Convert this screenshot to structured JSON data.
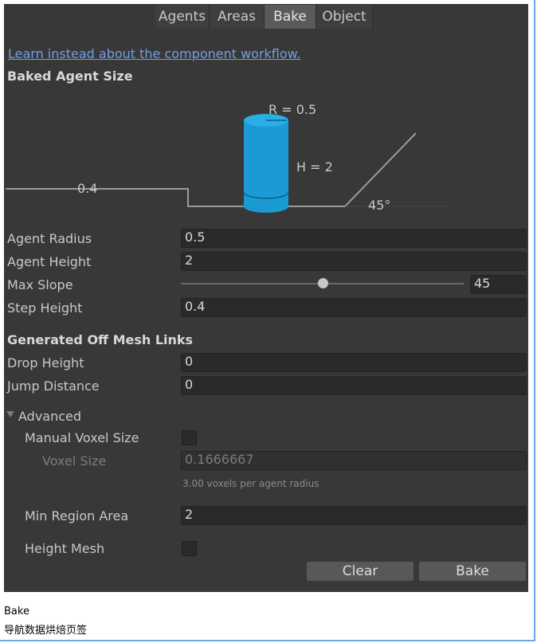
{
  "tabs": [
    "Agents",
    "Areas",
    "Bake",
    "Object"
  ],
  "link": "Learn instead about the component workflow.",
  "section_baked": "Baked Agent Size",
  "diagram": {
    "r_label": "R = 0.5",
    "h_label": "H = 2",
    "step_label": "0.4",
    "slope_label": "45°"
  },
  "fields": {
    "agent_radius": {
      "label": "Agent Radius",
      "value": "0.5"
    },
    "agent_height": {
      "label": "Agent Height",
      "value": "2"
    },
    "max_slope": {
      "label": "Max Slope",
      "value": "45",
      "fraction": 0.5
    },
    "step_height": {
      "label": "Step Height",
      "value": "0.4"
    }
  },
  "section_links": "Generated Off Mesh Links",
  "links": {
    "drop_height": {
      "label": "Drop Height",
      "value": "0"
    },
    "jump_distance": {
      "label": "Jump Distance",
      "value": "0"
    }
  },
  "advanced": {
    "title": "Advanced",
    "manual_voxel": "Manual Voxel Size",
    "voxel_size_label": "Voxel Size",
    "voxel_size_value": "0.1666667",
    "voxel_note": "3.00 voxels per agent radius",
    "min_region_label": "Min Region Area",
    "min_region_value": "2",
    "height_mesh": "Height Mesh"
  },
  "buttons": {
    "clear": "Clear",
    "bake": "Bake"
  },
  "caption": {
    "line1": "Bake",
    "line2": "导航数据烘焙页签"
  },
  "colors": {
    "cylinder": "#1a9bd6",
    "link": "#6f9fe8"
  }
}
